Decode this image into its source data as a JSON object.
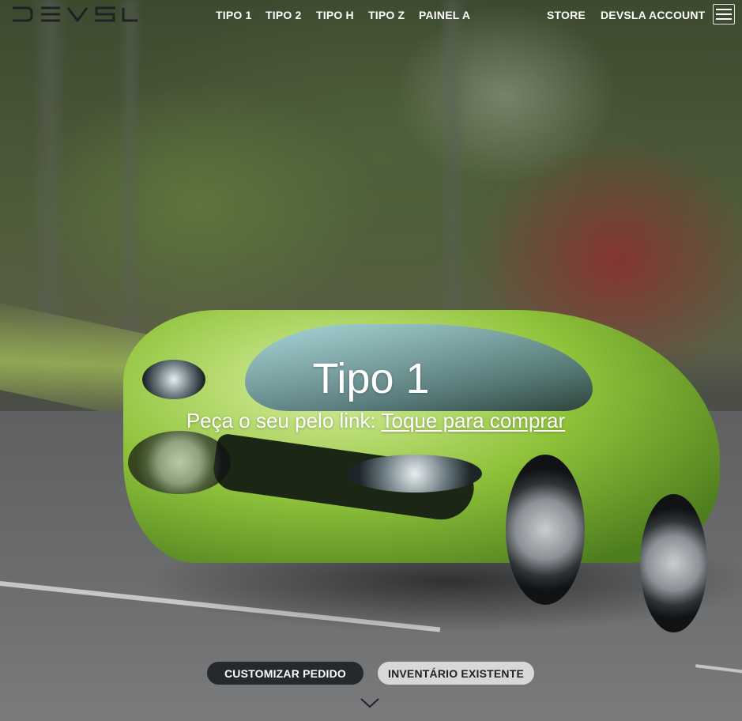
{
  "brand": {
    "logo_text": "DEVSLA"
  },
  "nav": {
    "items": [
      {
        "label": "TIPO 1"
      },
      {
        "label": "TIPO 2"
      },
      {
        "label": "TIPO H"
      },
      {
        "label": "TIPO Z"
      },
      {
        "label": "PAINEL A"
      }
    ]
  },
  "utility": {
    "store": "STORE",
    "account": "DEVSLA ACCOUNT",
    "menu_icon": "hamburger-icon"
  },
  "hero": {
    "title": "Tipo 1",
    "subtitle_prefix": "Peça o seu pelo link: ",
    "subtitle_link": "Toque para comprar",
    "image": "green sports car on road"
  },
  "actions": {
    "primary": "CUSTOMIZAR PEDIDO",
    "secondary": "INVENTÁRIO EXISTENTE",
    "scroll_icon": "chevron-down-icon"
  },
  "colors": {
    "primary_button_bg": "#25282c",
    "secondary_button_bg": "#e1e1e1",
    "text_light": "#ffffff"
  }
}
